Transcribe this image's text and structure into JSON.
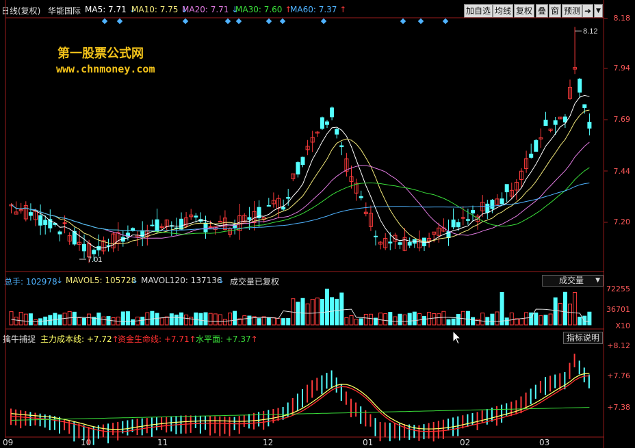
{
  "header": {
    "period": "日线(复权)",
    "stock_name": "华能国际",
    "ma": [
      {
        "label": "MA5: 7.71",
        "arrow": "↓",
        "color": "#ffffff"
      },
      {
        "label": "MA10: 7.75",
        "arrow": "↓",
        "color": "#f2e87a"
      },
      {
        "label": "MA20: 7.71",
        "arrow": "↓",
        "color": "#e07ae0"
      },
      {
        "label": "MA30: 7.60",
        "arrow": "↑",
        "color": "#3adf3a"
      },
      {
        "label": "MA60: 7.37",
        "arrow": "↑",
        "color": "#4fb3ff"
      }
    ]
  },
  "toolbar": {
    "buttons": [
      "加自选",
      "均线",
      "复权",
      "叠",
      "窗",
      "预测"
    ],
    "nav_icon": "arrow-right-icon",
    "menu_icon": "chevron-down-icon"
  },
  "watermark": {
    "line1": "第一股票公式网",
    "line2": "www.chnmoney.com"
  },
  "main_chart": {
    "price_axis": [
      "8.18",
      "7.94",
      "7.69",
      "7.44",
      "7.20"
    ],
    "high_label": "8.12",
    "low_label": "7.01"
  },
  "volume_panel": {
    "total": {
      "label": "总手: 102978",
      "arrow": "↓"
    },
    "mavol5": {
      "label": "MAVOL5: 105728",
      "arrow": "↓"
    },
    "mavol120": {
      "label": "MAVOL120: 137136",
      "arrow": "↓"
    },
    "note": "成交量已复权",
    "selector": "成交量",
    "axis": [
      "72255",
      "36701",
      "X10"
    ]
  },
  "indicator_panel": {
    "name": "擒牛捕捉",
    "lines": [
      {
        "label": "主力成本线: +7.72",
        "arrow": "↑",
        "color": "#ffff66"
      },
      {
        "label": "资金生命线: +7.71",
        "arrow": "↑",
        "color": "#ff3030"
      },
      {
        "label": "水平面: +7.37",
        "arrow": "↑",
        "color": "#3adf3a"
      }
    ],
    "help_button": "指标说明",
    "axis": [
      "+8.12",
      "+7.76",
      "+7.38"
    ]
  },
  "date_axis": [
    "09",
    "10",
    "11",
    "12",
    "01",
    "02",
    "03"
  ],
  "colors": {
    "up": "#ff3b3b",
    "down": "#54ffff",
    "grid": "#9b1b1b",
    "axis_text": "#ff5a5a"
  },
  "chart_data": {
    "type": "candlestick",
    "title": "日线(复权) 华能国际",
    "x": [
      "09",
      "10",
      "11",
      "12",
      "01",
      "02",
      "03"
    ],
    "series": [
      {
        "name": "MA5",
        "values": [
          7.2,
          7.12,
          7.18,
          7.25,
          7.62,
          7.58,
          7.25,
          7.18,
          7.28,
          7.48,
          7.78,
          7.71
        ]
      },
      {
        "name": "MA10",
        "values": [
          7.21,
          7.13,
          7.17,
          7.22,
          7.52,
          7.68,
          7.3,
          7.17,
          7.26,
          7.42,
          7.72,
          7.75
        ]
      },
      {
        "name": "MA20",
        "values": [
          7.22,
          7.15,
          7.16,
          7.2,
          7.4,
          7.48,
          7.34,
          7.2,
          7.24,
          7.38,
          7.62,
          7.71
        ]
      },
      {
        "name": "MA30",
        "values": [
          7.24,
          7.18,
          7.17,
          7.18,
          7.3,
          7.36,
          7.32,
          7.22,
          7.22,
          7.3,
          7.48,
          7.6
        ]
      },
      {
        "name": "MA60",
        "values": [
          7.26,
          7.22,
          7.2,
          7.2,
          7.22,
          7.24,
          7.24,
          7.22,
          7.21,
          7.26,
          7.32,
          7.37
        ]
      }
    ],
    "ylim": [
      7.0,
      8.2
    ],
    "high": 8.12,
    "low": 7.01
  }
}
